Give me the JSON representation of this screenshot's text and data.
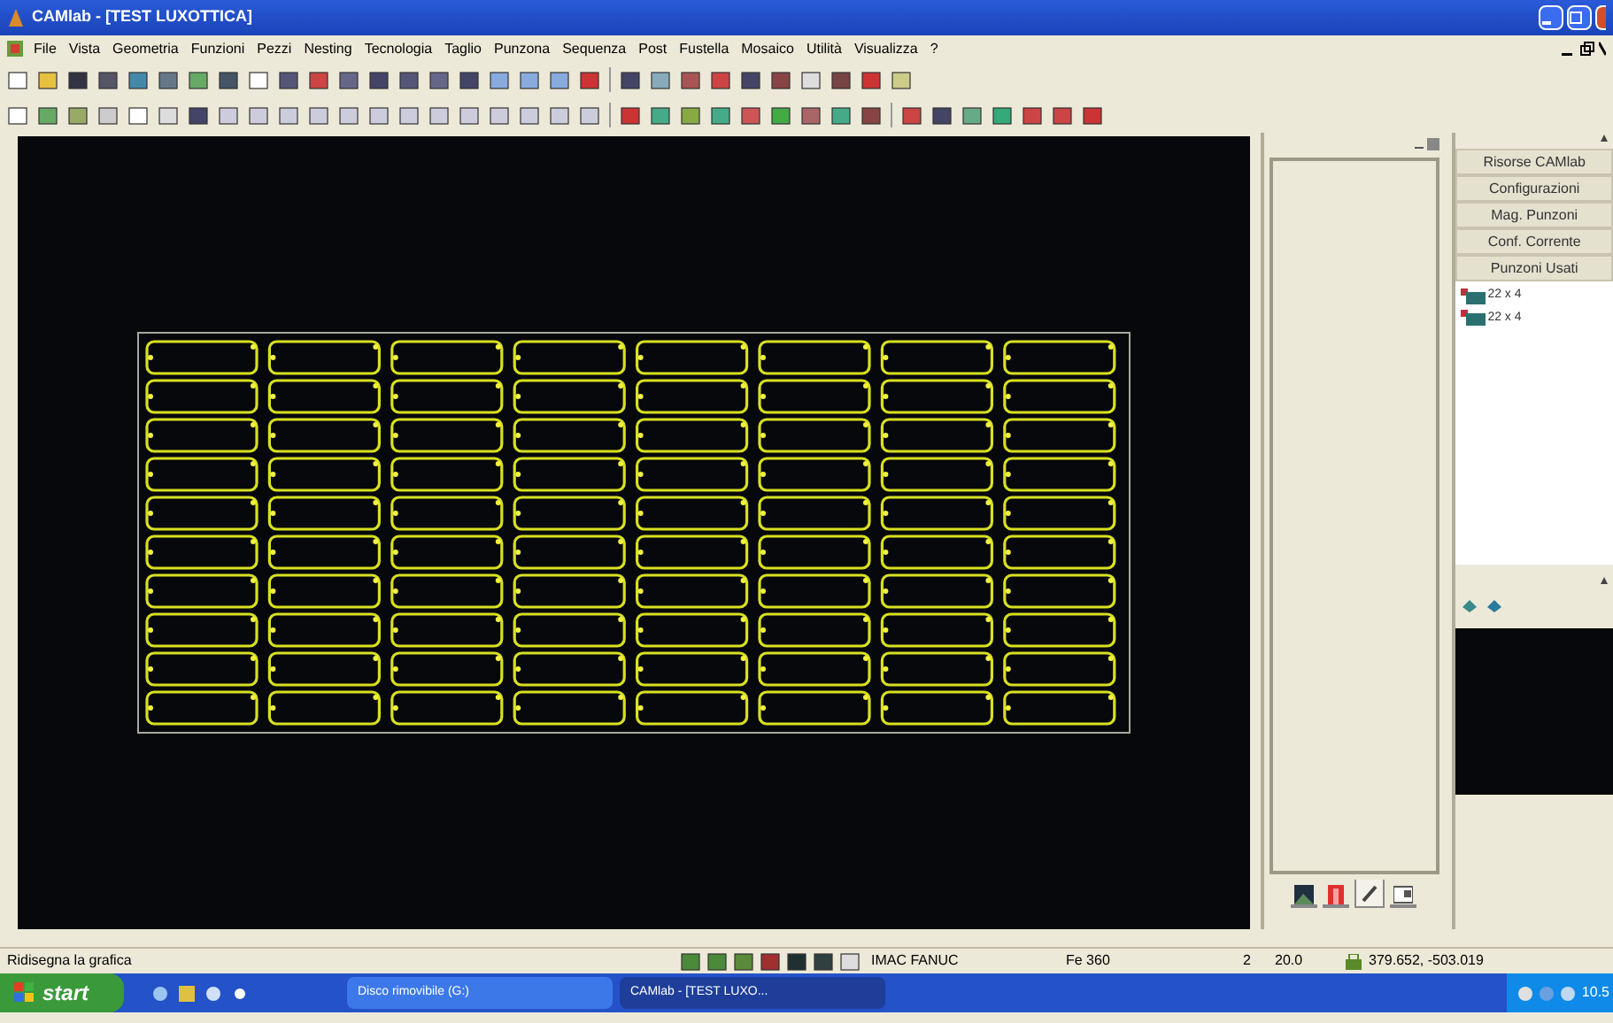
{
  "window": {
    "title": "CAMlab - [TEST LUXOTTICA]"
  },
  "menu": [
    "File",
    "Vista",
    "Geometria",
    "Funzioni",
    "Pezzi",
    "Nesting",
    "Tecnologia",
    "Taglio",
    "Punzona",
    "Sequenza",
    "Post",
    "Fustella",
    "Mosaico",
    "Utilità",
    "Visualizza",
    "?"
  ],
  "resources_panel": {
    "buttons": [
      "Risorse CAMlab",
      "Configurazioni",
      "Mag. Punzoni",
      "Conf. Corrente",
      "Punzoni Usati"
    ],
    "tree": [
      {
        "label": "22 x 4"
      },
      {
        "label": "22 x 4"
      }
    ]
  },
  "panel_tabs": [
    {
      "kind": "picture",
      "selected": false
    },
    {
      "kind": "red",
      "selected": false
    },
    {
      "kind": "pen",
      "selected": true
    },
    {
      "kind": "window",
      "selected": false
    }
  ],
  "status_bar": {
    "message": "Ridisegna la grafica",
    "machine": "IMAC FANUC",
    "material": "Fe 360",
    "field_3": "2",
    "field_4": "20.0",
    "coordinates": "379.652, -503.019"
  },
  "taskbar": {
    "start": "start",
    "tasks": [
      {
        "label": "Disco rimovibile (G:)",
        "selected": false
      },
      {
        "label": "CAMlab - [TEST LUXO...",
        "selected": true
      }
    ],
    "clock": "10.5"
  }
}
